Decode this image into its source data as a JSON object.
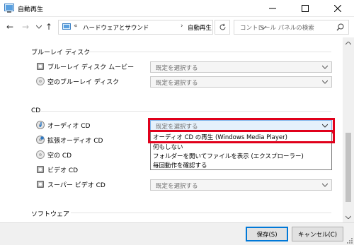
{
  "window": {
    "title": "自動再生"
  },
  "nav": {
    "back_label": "←",
    "forward_label": "→",
    "dropdown_label": "⌄",
    "up_label": "↑",
    "chevron": "«",
    "crumbs": [
      "ハードウェアとサウンド",
      "自動再生"
    ],
    "separator": "›",
    "search_placeholder": "コントロール パネルの検索"
  },
  "sections": {
    "bluray": {
      "title": "ブルーレイ ディスク",
      "rows": [
        {
          "label": "ブルーレイ ディスク ムービー",
          "value": "既定を選択する",
          "icon": "disc-player-icon"
        },
        {
          "label": "空のブルーレイ ディスク",
          "value": "既定を選択する",
          "icon": "blank-disc-icon"
        }
      ]
    },
    "cd": {
      "title": "CD",
      "rows": [
        {
          "label": "オーディオ CD",
          "value": "既定を選択する",
          "icon": "audio-cd-icon"
        },
        {
          "label": "拡張オーディオ CD",
          "value": "",
          "icon": "enhanced-audio-cd-icon"
        },
        {
          "label": "空の CD",
          "value": "",
          "icon": "blank-cd-icon"
        },
        {
          "label": "ビデオ CD",
          "value": "",
          "icon": "video-cd-icon"
        },
        {
          "label": "スーパー ビデオ CD",
          "value": "既定を選択する",
          "icon": "super-video-cd-icon"
        }
      ]
    },
    "software": {
      "title": "ソフトウェア"
    }
  },
  "dropdown": {
    "options": [
      "オーディオ CD の再生 (Windows Media Player)",
      "何もしない",
      "フォルダーを開いてファイルを表示 (エクスプローラー)",
      "毎回動作を確認する"
    ]
  },
  "footer": {
    "save_label": "保存(S)",
    "cancel_label": "キャンセル(C)"
  },
  "colors": {
    "highlight_border": "#e0001b",
    "selection_bg": "#e5f1fb",
    "accent": "#0078d7"
  }
}
